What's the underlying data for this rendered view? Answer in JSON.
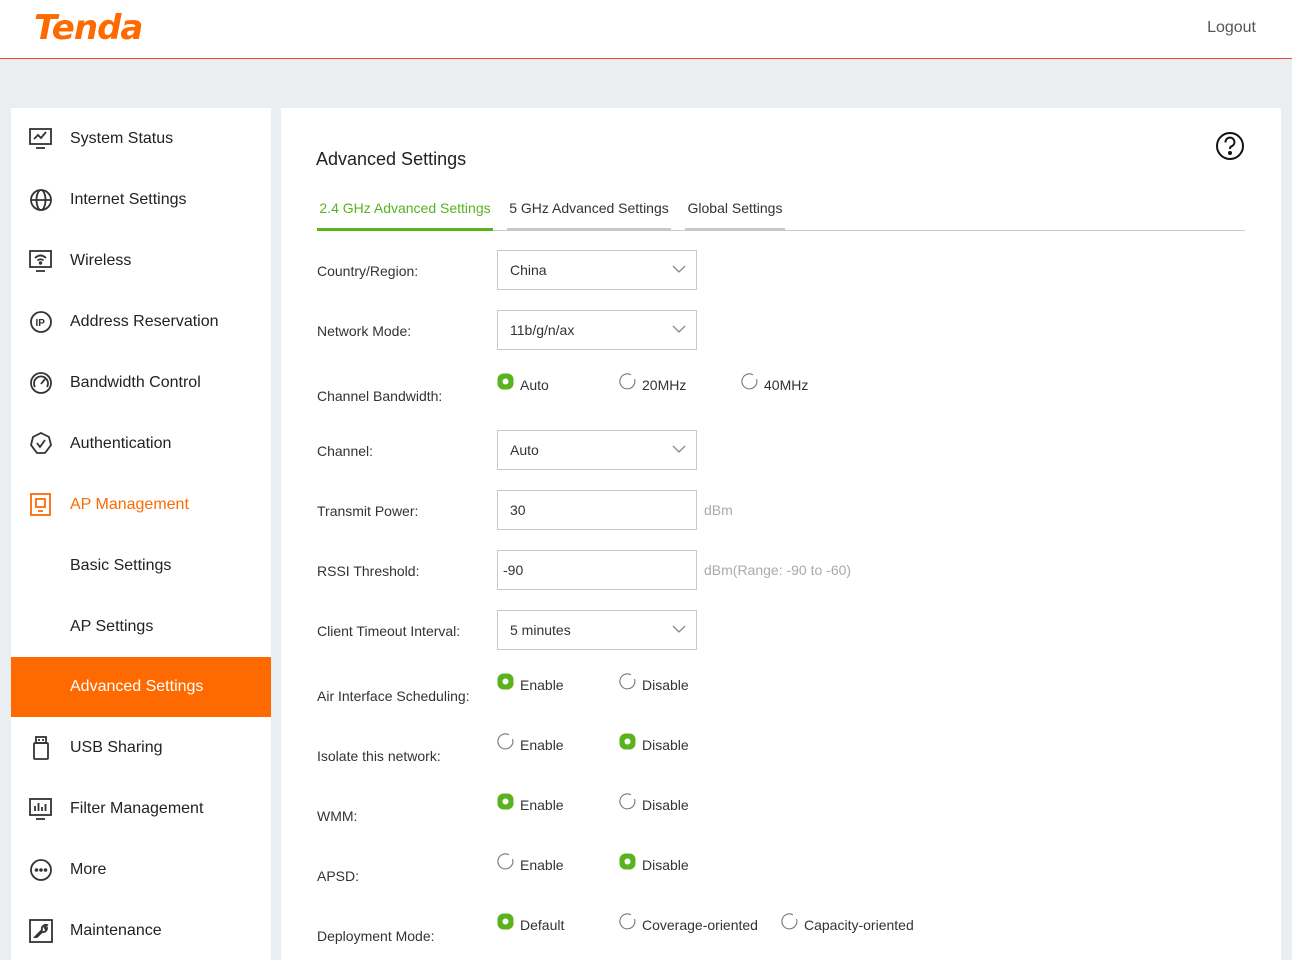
{
  "header": {
    "logo_text": "Tenda",
    "logout": "Logout"
  },
  "sidebar": {
    "items": [
      {
        "label": "System Status",
        "icon": "monitor-chart-icon"
      },
      {
        "label": "Internet Settings",
        "icon": "globe-icon"
      },
      {
        "label": "Wireless",
        "icon": "wifi-screen-icon"
      },
      {
        "label": "Address Reservation",
        "icon": "ip-icon"
      },
      {
        "label": "Bandwidth Control",
        "icon": "gauge-icon"
      },
      {
        "label": "Authentication",
        "icon": "shield-check-icon"
      },
      {
        "label": "AP Management",
        "icon": "ap-device-icon"
      },
      {
        "label": "Basic Settings"
      },
      {
        "label": "AP Settings"
      },
      {
        "label": "Advanced Settings"
      },
      {
        "label": "USB Sharing",
        "icon": "usb-icon"
      },
      {
        "label": "Filter Management",
        "icon": "filter-chart-icon"
      },
      {
        "label": "More",
        "icon": "more-dots-icon"
      },
      {
        "label": "Maintenance",
        "icon": "wrench-icon"
      }
    ]
  },
  "main": {
    "title": "Advanced Settings",
    "tabs": [
      "2.4 GHz Advanced Settings",
      "5 GHz Advanced Settings",
      "Global Settings"
    ],
    "fields": {
      "country": {
        "label": "Country/Region:",
        "value": "China"
      },
      "network_mode": {
        "label": "Network Mode:",
        "value": "11b/g/n/ax"
      },
      "channel_bandwidth": {
        "label": "Channel Bandwidth:",
        "options": [
          "Auto",
          "20MHz",
          "40MHz"
        ],
        "selected": "Auto"
      },
      "channel": {
        "label": "Channel:",
        "value": "Auto"
      },
      "transmit_power": {
        "label": "Transmit Power:",
        "value": "30",
        "unit": "dBm"
      },
      "rssi": {
        "label": "RSSI Threshold:",
        "value": "-90",
        "unit": "dBm(Range: -90 to -60)"
      },
      "client_timeout": {
        "label": "Client Timeout Interval:",
        "value": "5 minutes"
      },
      "air_interface": {
        "label": "Air Interface Scheduling:",
        "options": [
          "Enable",
          "Disable"
        ],
        "selected": "Enable"
      },
      "isolate": {
        "label": "Isolate this network:",
        "options": [
          "Enable",
          "Disable"
        ],
        "selected": "Disable"
      },
      "wmm": {
        "label": "WMM:",
        "options": [
          "Enable",
          "Disable"
        ],
        "selected": "Enable"
      },
      "apsd": {
        "label": "APSD:",
        "options": [
          "Enable",
          "Disable"
        ],
        "selected": "Disable"
      },
      "deployment": {
        "label": "Deployment Mode:",
        "options": [
          "Default",
          "Coverage-oriented",
          "Capacity-oriented"
        ],
        "selected": "Default"
      }
    }
  },
  "colors": {
    "accent": "#ff6a00",
    "green": "#59b31f",
    "header_line": "#e8463b"
  }
}
